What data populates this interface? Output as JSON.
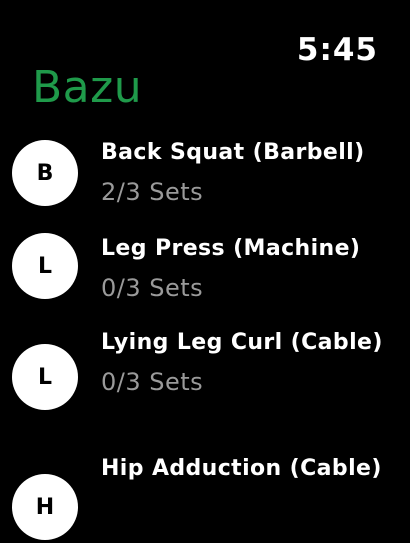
{
  "status": {
    "time": "5:45"
  },
  "app": {
    "title": "Bazu",
    "accent_color": "#1f9a4a"
  },
  "exercises": [
    {
      "initial": "B",
      "name": "Back Squat (Barbell)",
      "sets": "2/3 Sets"
    },
    {
      "initial": "L",
      "name": "Leg Press (Machine)",
      "sets": "0/3 Sets"
    },
    {
      "initial": "L",
      "name": "Lying Leg Curl (Cable)",
      "sets": "0/3 Sets"
    },
    {
      "initial": "H",
      "name": "Hip Adduction (Cable)",
      "sets": ""
    }
  ]
}
